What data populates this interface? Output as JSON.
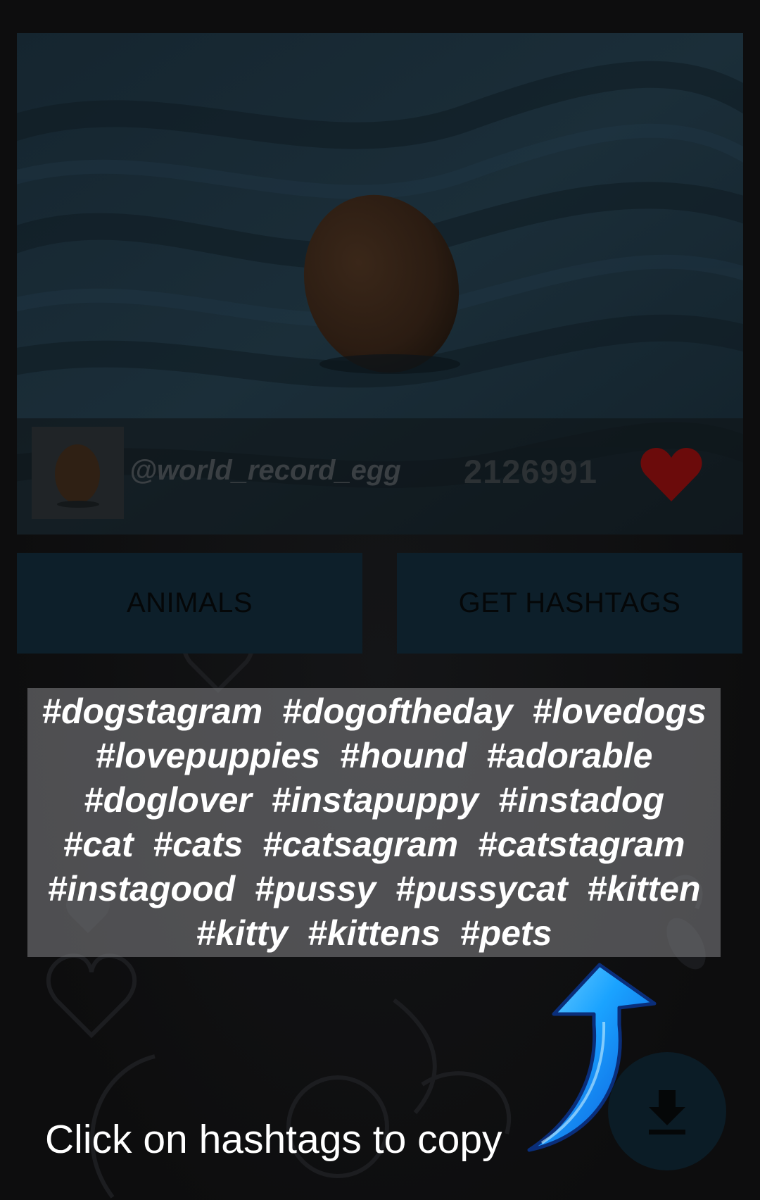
{
  "post": {
    "username": "@world_record_egg",
    "likes": "2126991",
    "heart_color": "#6b0b0b"
  },
  "buttons": {
    "category_label": "ANIMALS",
    "get_hashtags_label": "GET HASHTAGS"
  },
  "hashtags": {
    "lines": [
      "#dogstagram  #dogoftheday  #lovedogs",
      "#lovepuppies  #hound  #adorable",
      "#doglover  #instapuppy  #instadog",
      "#cat  #cats  #catsagram  #catstagram",
      "#instagood  #pussy  #pussycat  #kitten",
      "#kitty  #kittens  #pets"
    ]
  },
  "hint": {
    "text": "Click on hashtags to copy"
  },
  "icons": {
    "arrow": "curved-arrow-up-icon",
    "fab": "download-icon",
    "heart": "heart-icon"
  },
  "colors": {
    "accent_blue": "#1aa3ff",
    "button_bg": "#0d1f2a",
    "hashtag_box": "#78787a"
  }
}
